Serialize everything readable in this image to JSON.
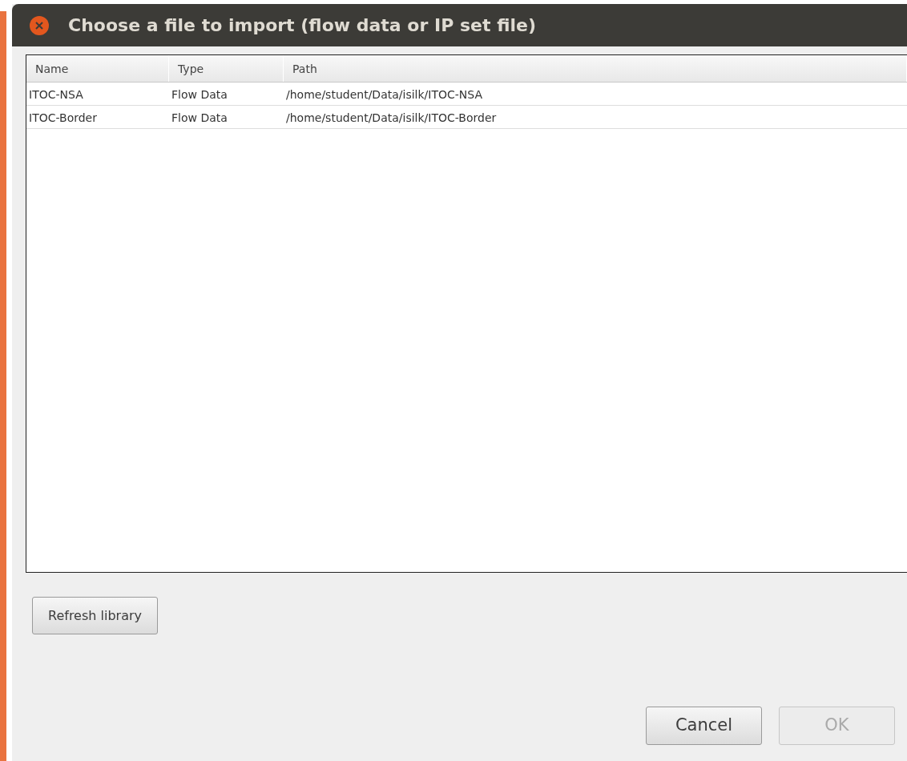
{
  "window": {
    "title": "Choose a file to import (flow data or IP set file)"
  },
  "table": {
    "columns": [
      "Name",
      "Type",
      "Path"
    ],
    "rows": [
      {
        "cells": [
          "ITOC-NSA",
          "Flow Data",
          "/home/student/Data/isilk/ITOC-NSA"
        ]
      },
      {
        "cells": [
          "ITOC-Border",
          "Flow Data",
          "/home/student/Data/isilk/ITOC-Border"
        ]
      }
    ]
  },
  "refresh_button": {
    "label": "Refresh library",
    "disabled": false
  },
  "buttons": [
    {
      "label": "Cancel",
      "disabled": false
    },
    {
      "label": "OK",
      "disabled": true
    }
  ]
}
